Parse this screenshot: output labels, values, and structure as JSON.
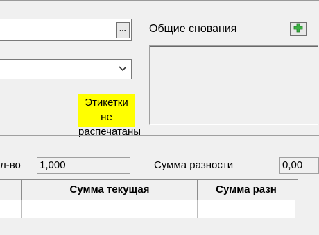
{
  "top": {
    "lookup_button_label": "...",
    "general_reasons_label": "Общие снования",
    "add_button_symbol": "+"
  },
  "labels_status": {
    "line1": "Этикетки не",
    "line2": "распечатаны",
    "highlight_color": "#ffff00"
  },
  "totals": {
    "qty_label": "л-во",
    "qty_value": "1,000",
    "diff_sum_label": "Сумма разности",
    "diff_sum_value": "0,00"
  },
  "grid": {
    "columns": [
      "Сумма текущая",
      "Сумма разн"
    ]
  },
  "colors": {
    "add_icon": "#3cb043",
    "window_bg": "#f0f0f0"
  }
}
